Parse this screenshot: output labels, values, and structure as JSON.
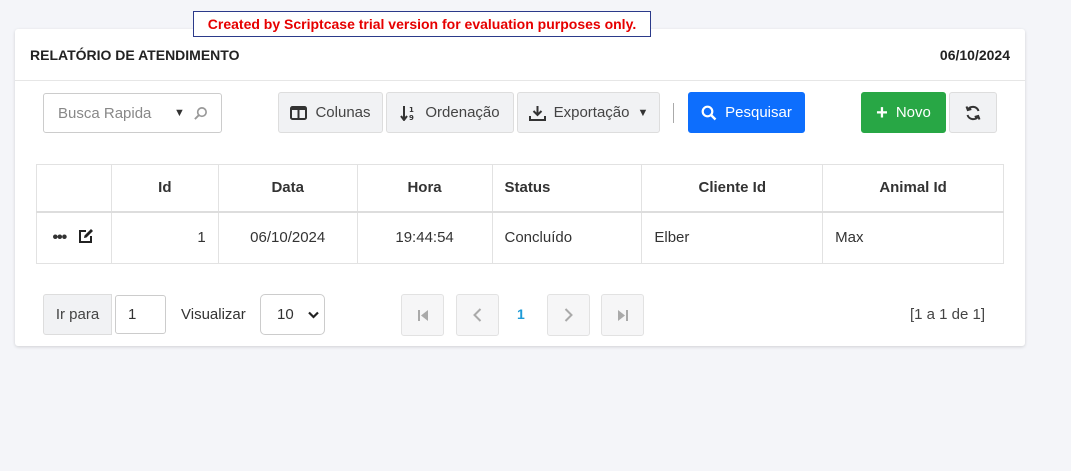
{
  "trial_notice": "Created by Scriptcase trial version for evaluation purposes only.",
  "header": {
    "title": "RELATÓRIO DE ATENDIMENTO",
    "date": "06/10/2024"
  },
  "toolbar": {
    "search_placeholder": "Busca Rapida",
    "columns_label": "Colunas",
    "sort_label": "Ordenação",
    "export_label": "Exportação",
    "search_button": "Pesquisar",
    "new_button": "Novo"
  },
  "table": {
    "headers": [
      "",
      "Id",
      "Data",
      "Hora",
      "Status",
      "Cliente Id",
      "Animal Id"
    ],
    "rows": [
      {
        "id": "1",
        "data": "06/10/2024",
        "hora": "19:44:54",
        "status": "Concluído",
        "cliente": "Elber",
        "animal": "Max"
      }
    ]
  },
  "pager": {
    "goto_label": "Ir para",
    "goto_value": "1",
    "view_label": "Visualizar",
    "view_selected": "10",
    "current_page": "1",
    "summary": "[1 a 1 de 1]"
  },
  "colors": {
    "primary": "#0d6efd",
    "success": "#28a745",
    "notice": "#e60000",
    "page_link": "#1e9bd7"
  }
}
